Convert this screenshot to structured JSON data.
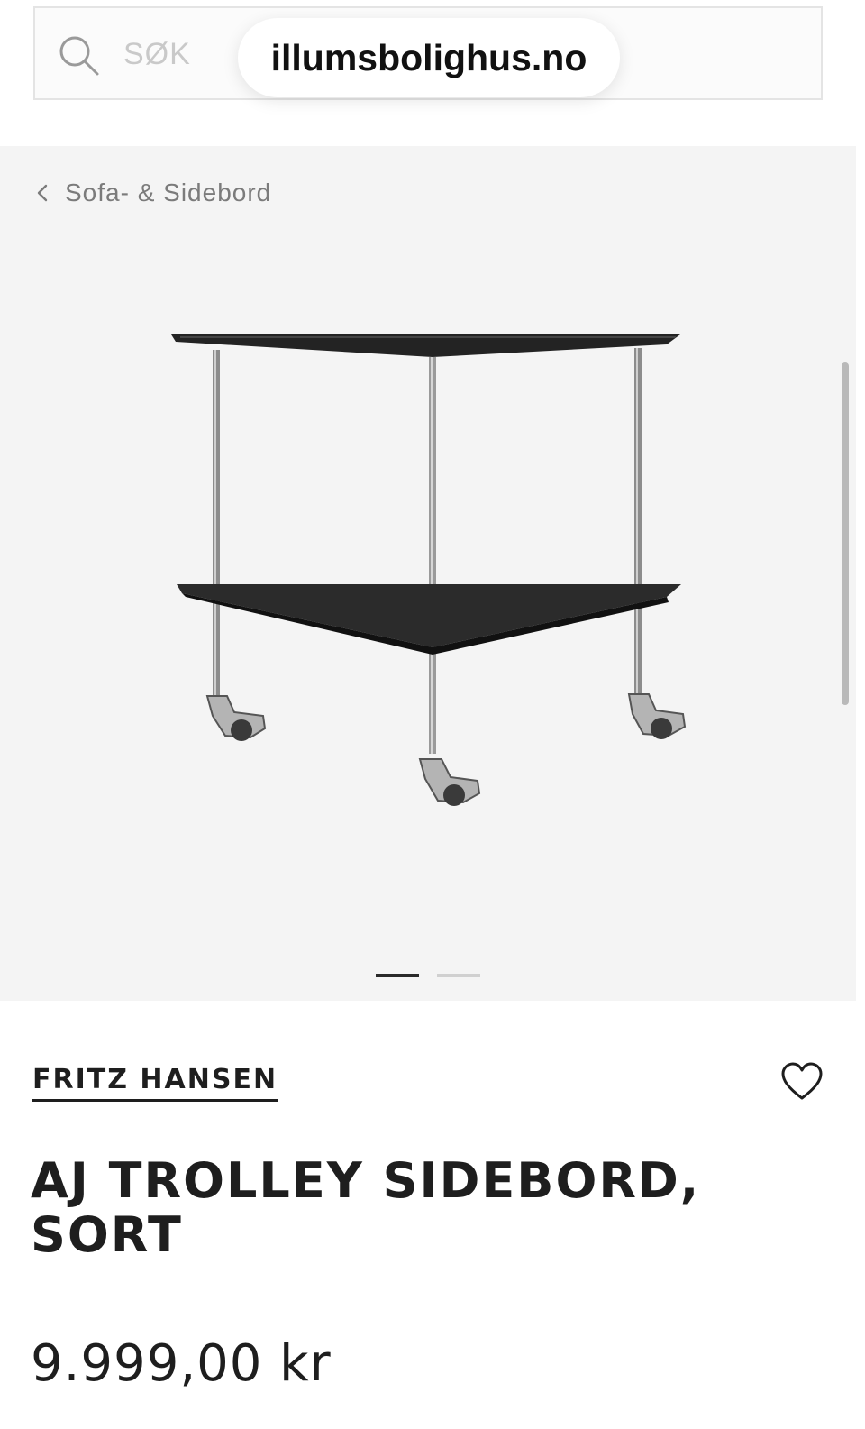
{
  "header": {
    "search_placeholder": "SØK",
    "url": "illumsbolighus.no"
  },
  "gallery": {
    "breadcrumb": "Sofa- & Sidebord",
    "slide_count": 2,
    "active_slide": 1
  },
  "product": {
    "brand": "FRITZ HANSEN",
    "title_line1": "AJ TROLLEY SIDEBORD,",
    "title_line2": "SORT",
    "price": "9.999,00 kr"
  },
  "icons": [
    "search-icon",
    "chevron-left-icon",
    "heart-icon"
  ]
}
